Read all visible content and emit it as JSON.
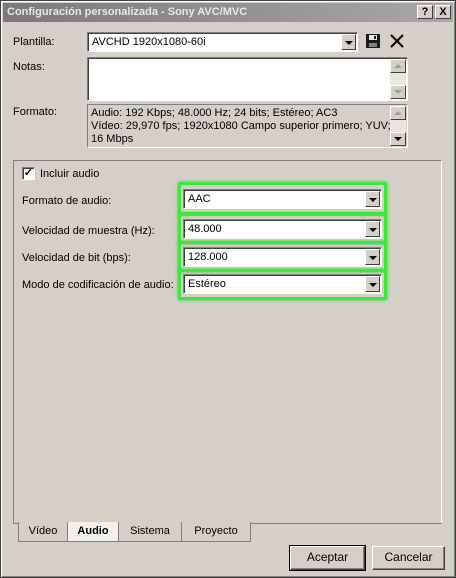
{
  "window": {
    "title": "Configuración personalizada - Sony AVC/MVC",
    "help": "?",
    "close": "X"
  },
  "plantilla": {
    "label": "Plantilla:",
    "value": "AVCHD 1920x1080-60i",
    "save_icon": "floppy-disk-icon",
    "delete_icon": "delete-x-icon"
  },
  "notas": {
    "label": "Notas:",
    "value": ""
  },
  "formato": {
    "label": "Formato:",
    "lines": [
      "Audio: 192 Kbps; 48.000 Hz; 24 bits; Estéreo; AC3",
      "Vídeo: 29,970 fps; 1920x1080 Campo superior primero; YUV;",
      "16 Mbps"
    ]
  },
  "audio": {
    "include_label": "Incluir audio",
    "include_checked": true,
    "fields": [
      {
        "label": "Formato de audio:",
        "value": "AAC"
      },
      {
        "label": "Velocidad de muestra (Hz):",
        "value": "48.000"
      },
      {
        "label": "Velocidad de bit (bps):",
        "value": "128.000"
      },
      {
        "label": "Modo de codificación de audio:",
        "value": "Estéreo"
      }
    ],
    "highlight_color": "#3ee63e"
  },
  "tabs": [
    "Vídeo",
    "Audio",
    "Sistema",
    "Proyecto"
  ],
  "active_tab": "Audio",
  "buttons": {
    "accept": "Aceptar",
    "cancel": "Cancelar"
  }
}
